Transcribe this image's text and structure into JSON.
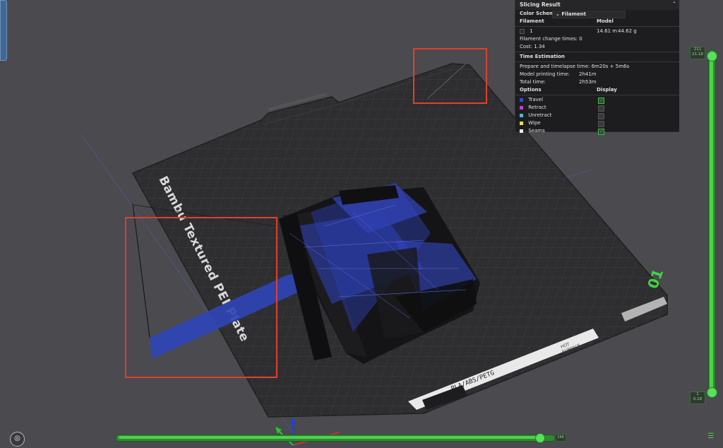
{
  "plate": {
    "name": "Bambu Textured PEI Plate",
    "material_label": "PLA/ABS/PETG",
    "hot_surface_line1": "HOT",
    "hot_surface_line2": "SURFACE",
    "plate_number": "01"
  },
  "panel": {
    "title": "Slicing Result",
    "color_scheme_label": "Color Scheme",
    "color_scheme_value": "Filament",
    "filament_header": "Filament",
    "model_header": "Model",
    "filament_index": "1",
    "model_length": "14.61 m",
    "model_weight": "44.62 g",
    "change_times_label": "Filament change times:",
    "change_times_value": "0",
    "cost_label": "Cost:",
    "cost_value": "1.34",
    "time_header": "Time Estimation",
    "prepare_label": "Prepare and timelapse time:",
    "prepare_value": "6m20s + 5m6s",
    "model_time_label": "Model printing time:",
    "model_time_value": "2h41m",
    "total_label": "Total time:",
    "total_value": "2h53m",
    "options_header": "Options",
    "display_header": "Display",
    "options": [
      {
        "label": "Travel",
        "color": "#2f4fd6",
        "checked": true
      },
      {
        "label": "Retract",
        "color": "#c33bd1",
        "checked": false
      },
      {
        "label": "Unretract",
        "color": "#3fb9d9",
        "checked": false
      },
      {
        "label": "Wipe",
        "color": "#e6e24a",
        "checked": false
      },
      {
        "label": "Seams",
        "color": "#e8e8e8",
        "checked": true
      }
    ]
  },
  "layer_slider": {
    "top_layer": "211",
    "top_height": "21.18",
    "bottom_layer": "1",
    "bottom_height": "0.18",
    "progress": 1.0
  },
  "move_slider": {
    "value_label": "196",
    "progress": 0.985
  },
  "colors": {
    "accent_green": "#4ed14e",
    "highlight_red": "#e0402c",
    "travel_blue": "#2f4fd6"
  }
}
